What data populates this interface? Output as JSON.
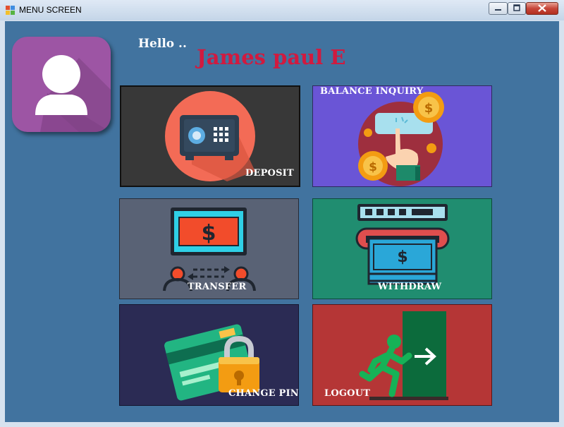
{
  "window": {
    "title": "MENU SCREEN"
  },
  "greeting": {
    "hello": "Hello ..",
    "name": "James paul E"
  },
  "tiles": {
    "deposit": {
      "label": "DEPOSIT",
      "bg": "#383838"
    },
    "balance_inquiry": {
      "label": "BALANCE INQUIRY",
      "bg": "#6a55d6"
    },
    "transfer": {
      "label": "TRANSFER",
      "bg": "#596275"
    },
    "withdraw": {
      "label": "WITHDRAW",
      "bg": "#208d70"
    },
    "change_pin": {
      "label": "CHANGE PIN",
      "bg": "#2b2b54"
    },
    "logout": {
      "label": "LOGOUT",
      "bg": "#b53636"
    }
  },
  "colors": {
    "client_bg": "#41739f",
    "name_color": "#d11a3f",
    "avatar_bg": "#9d55a4"
  },
  "icons": {
    "avatar": "user-silhouette-icon",
    "deposit": "safe-icon",
    "balance_inquiry": "touch-coin-icon",
    "transfer": "money-transfer-icon",
    "withdraw": "atm-cash-icon",
    "change_pin": "card-lock-icon",
    "logout": "exit-door-icon"
  }
}
